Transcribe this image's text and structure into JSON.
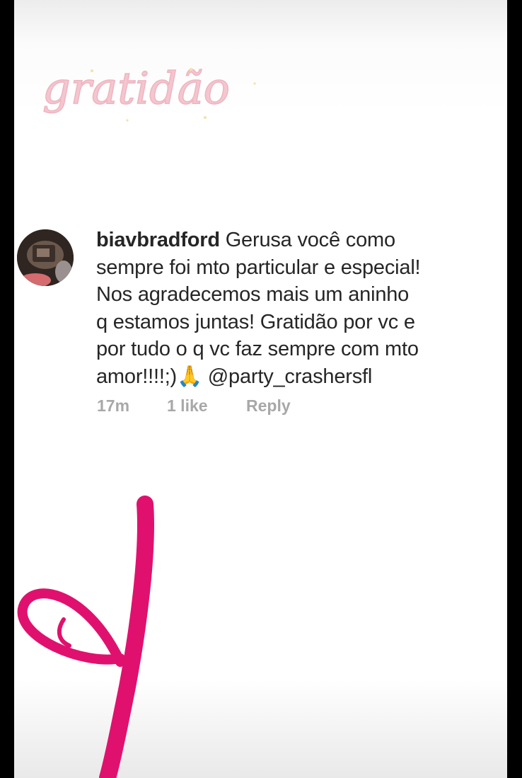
{
  "story": {
    "title_sticker": "gratidão"
  },
  "comment": {
    "username": "biavbradford",
    "lines": [
      " Gerusa você como",
      "sempre foi mto particular e especial!",
      "Nos agradecemos mais um aninho",
      "q estamos juntas! Gratidão por vc e",
      "por tudo o q vc faz sempre com mto",
      "amor!!!!;)🙏 @party_crashersfl"
    ],
    "time": "17m",
    "likes": "1 like",
    "reply": "Reply"
  },
  "colors": {
    "accent_pink": "#e0116e",
    "title_pink": "#f4c6cf",
    "meta_gray": "#a8a8a8",
    "text": "#262626"
  },
  "icons": {
    "emoji": "folded-hands"
  }
}
